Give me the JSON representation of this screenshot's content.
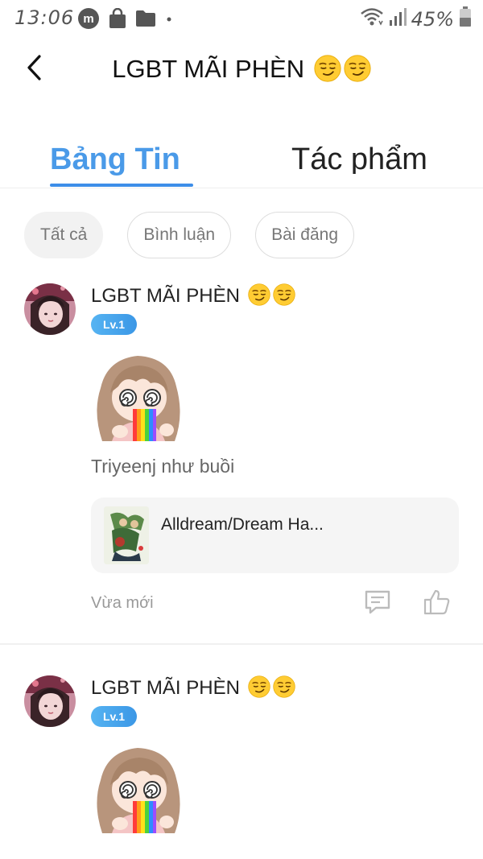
{
  "status_bar": {
    "time": "13:06",
    "battery": "45%",
    "icons_left": [
      "m-app-icon",
      "shopping-bag-icon",
      "folder-icon",
      "dot-icon"
    ],
    "icons_right": [
      "wifi-icon",
      "signal-icon",
      "battery-icon"
    ]
  },
  "header": {
    "back_icon": "chevron-left-icon",
    "title": "LGBT MÃI PHÈN"
  },
  "tabs": [
    {
      "label": "Bảng Tin",
      "active": true
    },
    {
      "label": "Tác phẩm",
      "active": false
    }
  ],
  "filters": [
    {
      "label": "Tất cả",
      "selected": true
    },
    {
      "label": "Bình luận",
      "selected": false
    },
    {
      "label": "Bài đăng",
      "selected": false
    }
  ],
  "posts": [
    {
      "author": "LGBT MÃI PHÈN",
      "level": "Lv.1",
      "text": "Triyeenj như buồi",
      "linked_work": {
        "title": "Alldream/Dream Ha..."
      },
      "time": "Vừa mới"
    },
    {
      "author": "LGBT MÃI PHÈN",
      "level": "Lv.1"
    }
  ],
  "colors": {
    "accent": "#4a9ae8",
    "badge": "#3b97e6",
    "muted_text": "#999999"
  }
}
